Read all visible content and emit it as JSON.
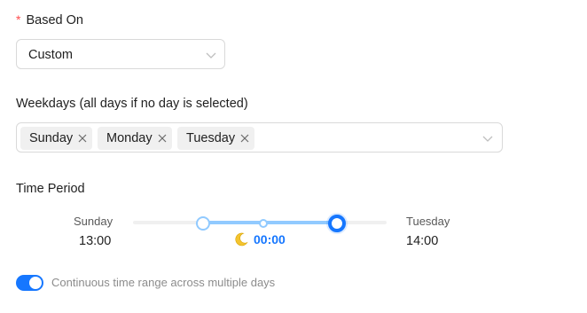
{
  "based_on": {
    "required_mark": "*",
    "label": "Based On",
    "selected": "Custom",
    "icon": "chevron-down-icon"
  },
  "weekdays": {
    "label": "Weekdays (all days if no day is selected)",
    "tags": [
      "Sunday",
      "Monday",
      "Tuesday"
    ],
    "tag_close_icon": "close-icon",
    "icon": "chevron-down-icon"
  },
  "time_period": {
    "label": "Time Period",
    "start": {
      "day": "Sunday",
      "time": "13:00"
    },
    "end": {
      "day": "Tuesday",
      "time": "14:00"
    },
    "midpoint": {
      "icon": "moon-icon",
      "time": "00:00"
    }
  },
  "continuous_toggle": {
    "on": true,
    "label": "Continuous time range across multiple days"
  },
  "colors": {
    "accent": "#1677ff",
    "track": "#91caff",
    "required": "#ff4d4f",
    "moon": "#f4c430"
  }
}
